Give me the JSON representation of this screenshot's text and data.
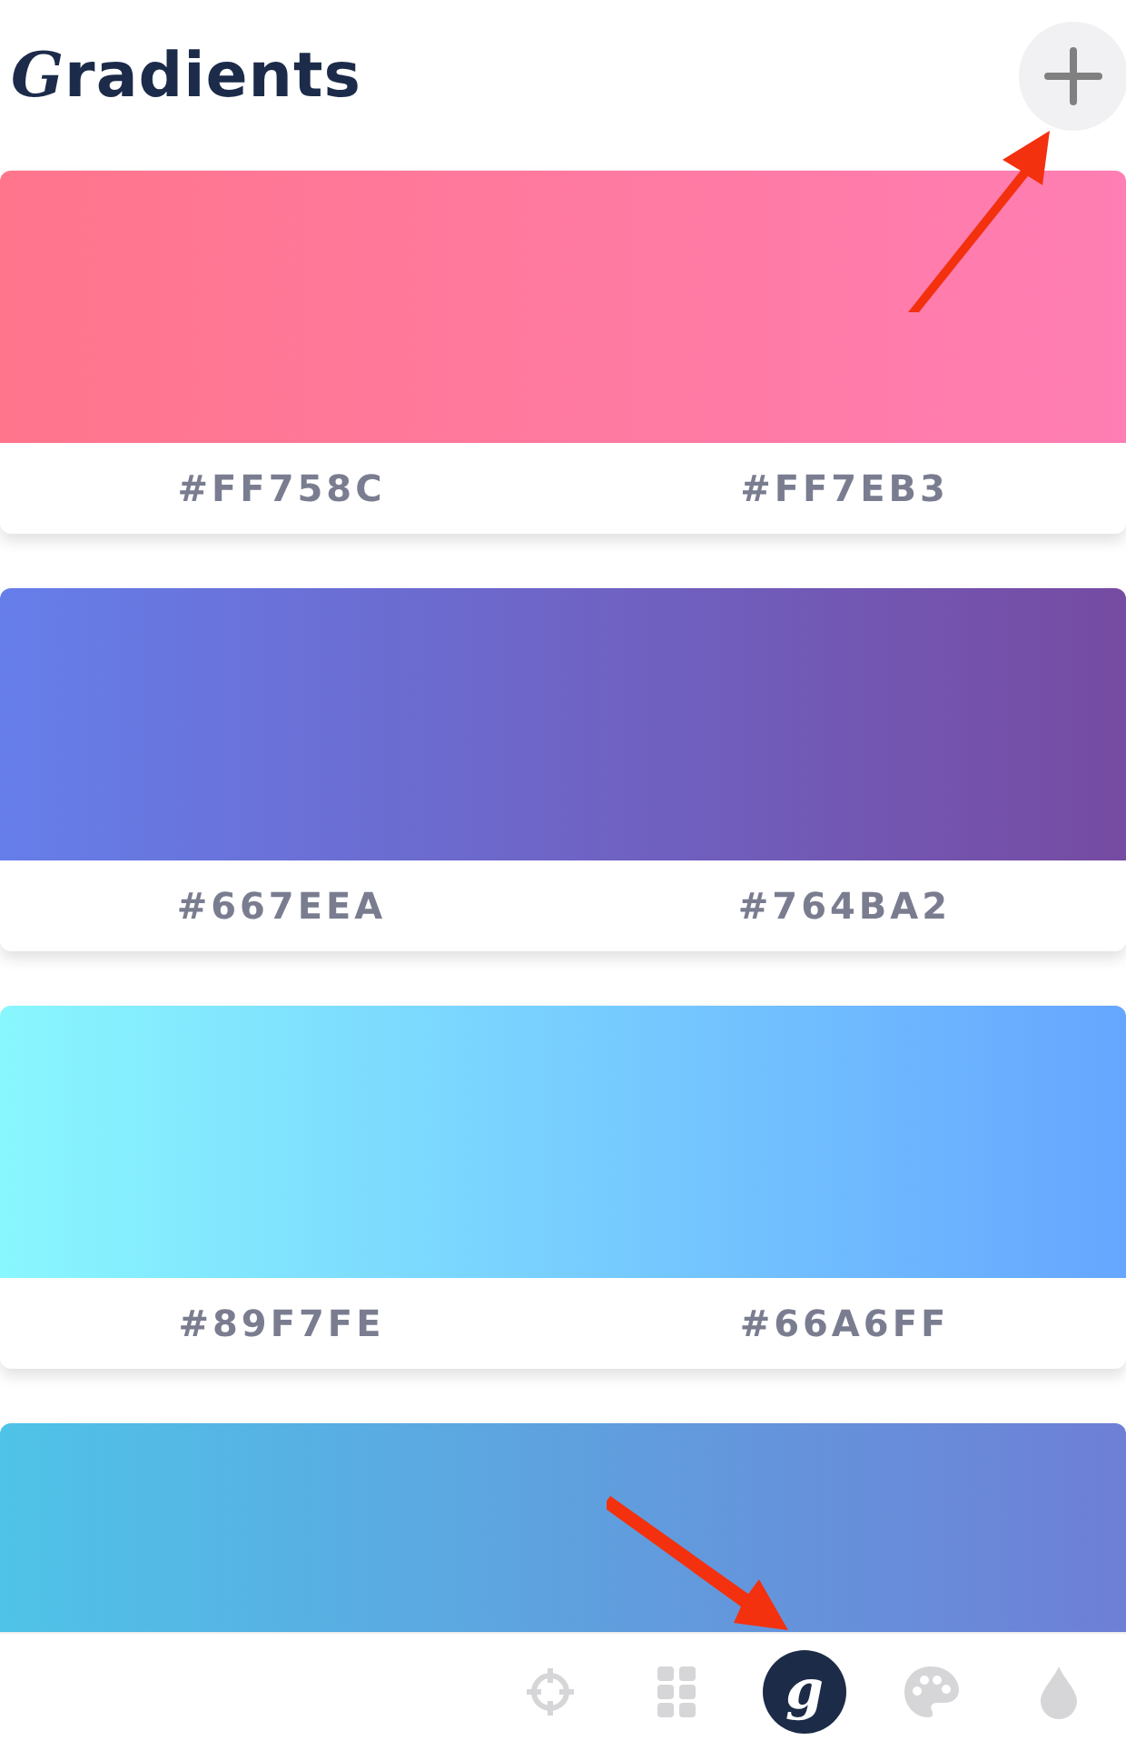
{
  "header": {
    "title": "Gradients"
  },
  "cards": [
    {
      "stops": [
        {
          "code": "#FF758C"
        },
        {
          "code": "#FF7EB3"
        }
      ]
    },
    {
      "stops": [
        {
          "code": "#667EEA"
        },
        {
          "code": "#764BA2"
        }
      ]
    },
    {
      "stops": [
        {
          "code": "#89F7FE"
        },
        {
          "code": "#66A6FF"
        }
      ]
    },
    {
      "stops": [
        {
          "color": "#4fc3e8"
        },
        {
          "color": "#6e7fd6"
        }
      ]
    }
  ],
  "nav": [
    {
      "kind": "target",
      "selected": false
    },
    {
      "kind": "grid",
      "selected": false
    },
    {
      "kind": "logo",
      "glyph": "g",
      "selected": true
    },
    {
      "kind": "palette",
      "selected": false
    },
    {
      "kind": "drop",
      "selected": false
    }
  ]
}
